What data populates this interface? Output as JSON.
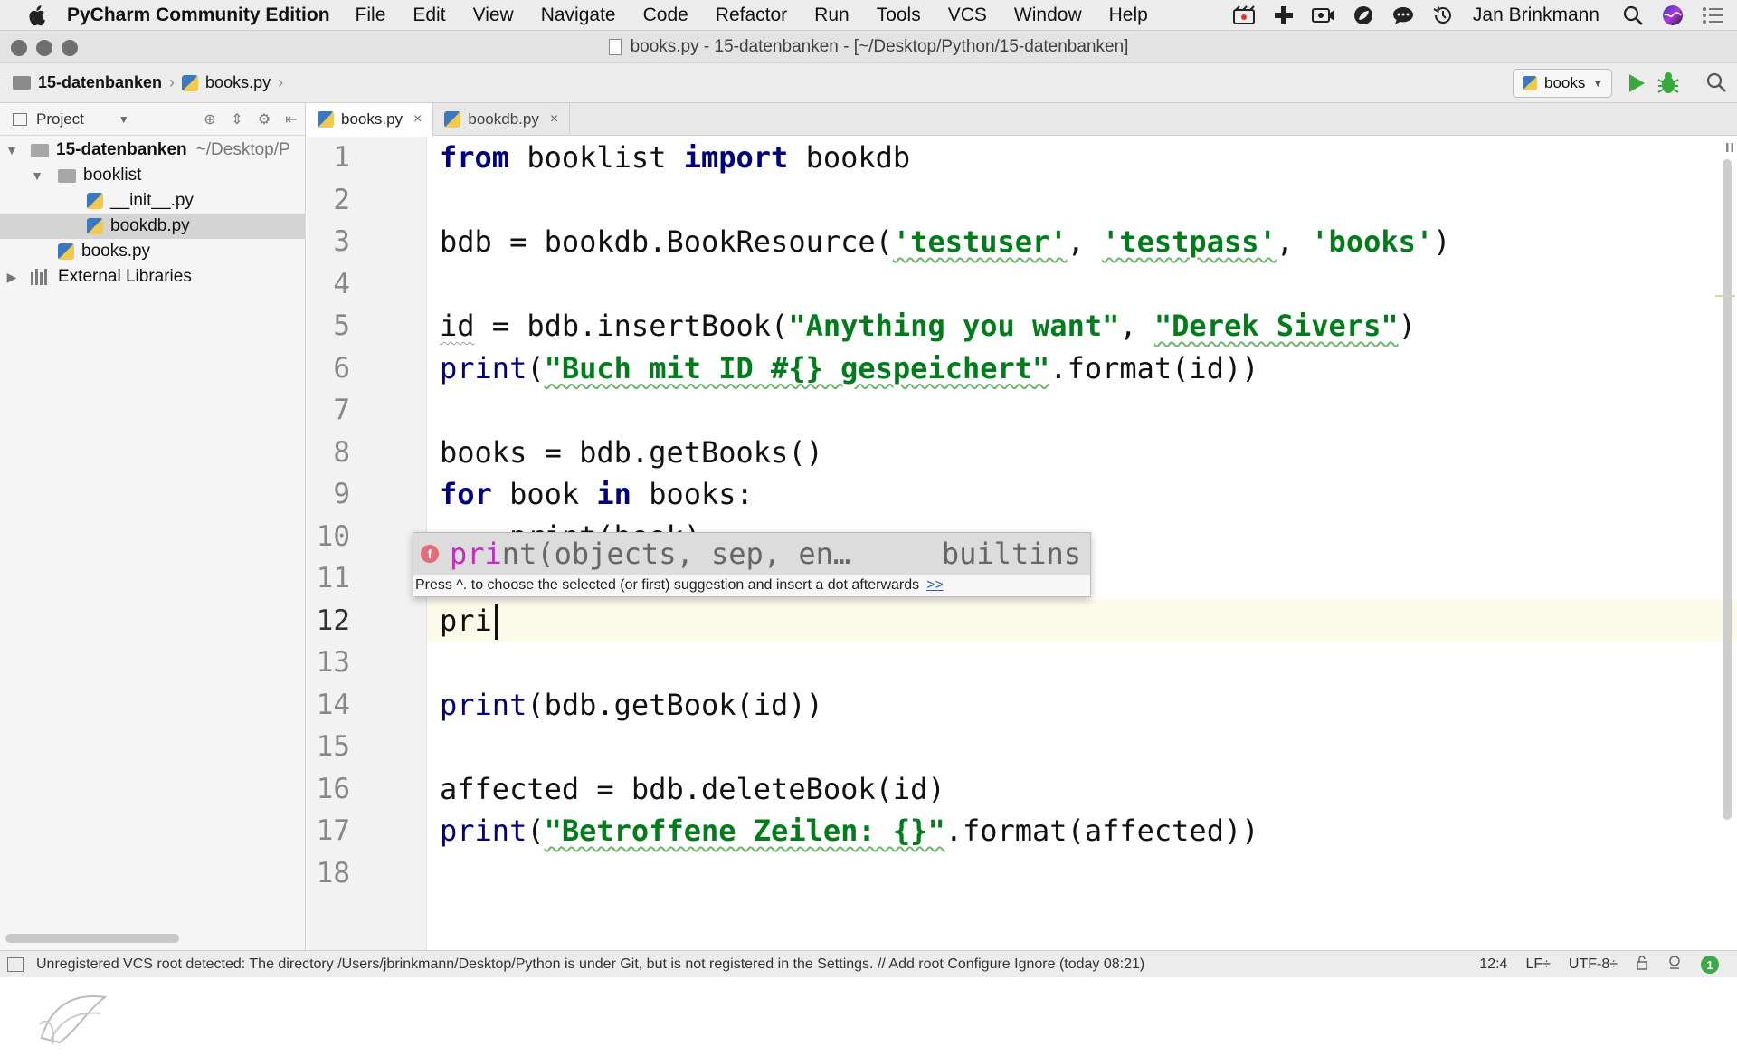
{
  "menubar": {
    "app_name": "PyCharm Community Edition",
    "menus": [
      "File",
      "Edit",
      "View",
      "Navigate",
      "Code",
      "Refactor",
      "Run",
      "Tools",
      "VCS",
      "Window",
      "Help"
    ],
    "user": "Jan Brinkmann"
  },
  "window": {
    "title": "books.py - 15-datenbanken - [~/Desktop/Python/15-datenbanken]"
  },
  "navbar": {
    "breadcrumbs": [
      "15-datenbanken",
      "books.py"
    ],
    "run_config": "books"
  },
  "project": {
    "header": "Project",
    "tree": [
      {
        "label": "15-datenbanken",
        "suffix": "~/Desktop/P"
      },
      {
        "label": "booklist"
      },
      {
        "label": "__init__.py"
      },
      {
        "label": "bookdb.py"
      },
      {
        "label": "books.py"
      },
      {
        "label": "External Libraries"
      }
    ]
  },
  "tabs": [
    {
      "label": "books.py",
      "close": "×"
    },
    {
      "label": "bookdb.py",
      "close": "×"
    }
  ],
  "editor": {
    "line_numbers": [
      "1",
      "2",
      "3",
      "4",
      "5",
      "6",
      "7",
      "8",
      "9",
      "10",
      "11",
      "12",
      "13",
      "14",
      "15",
      "16",
      "17",
      "18"
    ],
    "current_line": 12,
    "code": {
      "l1_kw1": "from",
      "l1_mod": " booklist ",
      "l1_kw2": "import",
      "l1_rest": " bookdb",
      "l3_pre": "bdb = bookdb.BookResource(",
      "l3_s1": "'testuser'",
      "l3_c1": ", ",
      "l3_s2": "'testpass'",
      "l3_c2": ", ",
      "l3_s3": "'books'",
      "l3_post": ")",
      "l5_id": "id",
      "l5_pre": " = bdb.insertBook(",
      "l5_s1": "\"Anything you want\"",
      "l5_c": ", ",
      "l5_s2": "\"Derek Sivers\"",
      "l5_post": ")",
      "l6_print": "print",
      "l6_open": "(",
      "l6_s": "\"Buch mit ID #{} gespeichert\"",
      "l6_post": ".format(id))",
      "l8": "books = bdb.getBooks()",
      "l9_kw1": "for",
      "l9_mid": " book ",
      "l9_kw2": "in",
      "l9_post": " books:",
      "l10": "    print(book)",
      "l12": "pri",
      "l14_print": "print",
      "l14_post": "(bdb.getBook(id))",
      "l16": "affected = bdb.deleteBook(id)",
      "l17_print": "print",
      "l17_open": "(",
      "l17_s": "\"Betroffene Zeilen: {}\"",
      "l17_post": ".format(affected))"
    }
  },
  "completion": {
    "match": "pri",
    "rest": "nt(objects, sep, en…",
    "source": "builtins",
    "hint": "Press ^. to choose the selected (or first) suggestion and insert a dot afterwards",
    "hint_link": ">>"
  },
  "statusbar": {
    "message": "Unregistered VCS root detected: The directory /Users/jbrinkmann/Desktop/Python is under Git, but is not registered in the Settings. // Add root  Configure  Ignore (today 08:21)",
    "position": "12:4",
    "line_sep": "LF÷",
    "encoding": "UTF-8÷",
    "badge": "1"
  },
  "colors": {
    "keyword": "#000080",
    "string": "#007d1a",
    "completion_match": "#c02fc0",
    "current_line": "#fcfae8"
  }
}
